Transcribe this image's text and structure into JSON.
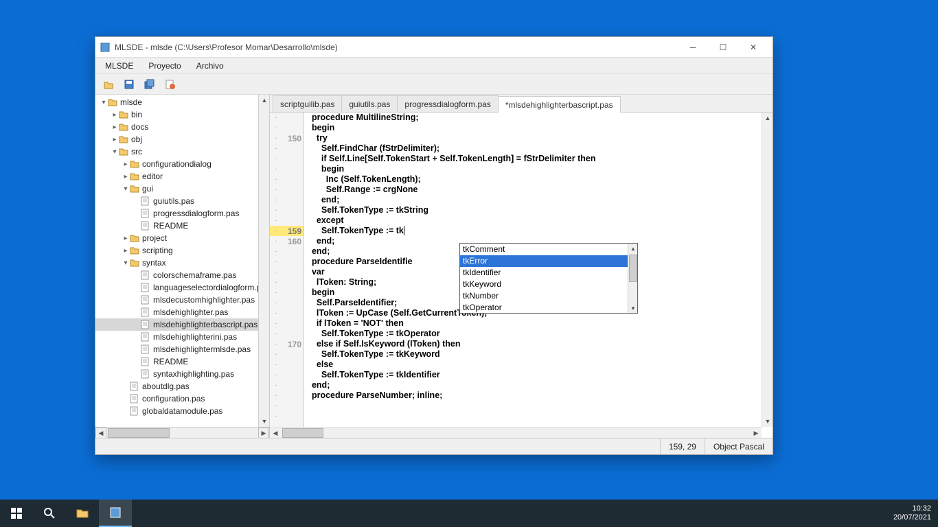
{
  "window": {
    "title": "MLSDE - mlsde (C:\\Users\\Profesor Momar\\Desarrollo\\mlsde)"
  },
  "menu": [
    "MLSDE",
    "Proyecto",
    "Archivo"
  ],
  "tree": [
    {
      "d": 0,
      "t": "mlsde",
      "k": "fo",
      "x": "▾"
    },
    {
      "d": 1,
      "t": "bin",
      "k": "fc",
      "x": "▸"
    },
    {
      "d": 1,
      "t": "docs",
      "k": "fc",
      "x": "▸"
    },
    {
      "d": 1,
      "t": "obj",
      "k": "fc",
      "x": "▸"
    },
    {
      "d": 1,
      "t": "src",
      "k": "fo",
      "x": "▾"
    },
    {
      "d": 2,
      "t": "configurationdialog",
      "k": "fc",
      "x": "▸"
    },
    {
      "d": 2,
      "t": "editor",
      "k": "fc",
      "x": "▸"
    },
    {
      "d": 2,
      "t": "gui",
      "k": "fo",
      "x": "▾"
    },
    {
      "d": 3,
      "t": "guiutils.pas",
      "k": "f"
    },
    {
      "d": 3,
      "t": "progressdialogform.pas",
      "k": "f"
    },
    {
      "d": 3,
      "t": "README",
      "k": "f"
    },
    {
      "d": 2,
      "t": "project",
      "k": "fc",
      "x": "▸"
    },
    {
      "d": 2,
      "t": "scripting",
      "k": "fc",
      "x": "▸"
    },
    {
      "d": 2,
      "t": "syntax",
      "k": "fo",
      "x": "▾"
    },
    {
      "d": 3,
      "t": "colorschemaframe.pas",
      "k": "f"
    },
    {
      "d": 3,
      "t": "languageselectordialogform.p",
      "k": "f"
    },
    {
      "d": 3,
      "t": "mlsdecustomhighlighter.pas",
      "k": "f"
    },
    {
      "d": 3,
      "t": "mlsdehighlighter.pas",
      "k": "f"
    },
    {
      "d": 3,
      "t": "mlsdehighlighterbascript.pas",
      "k": "f",
      "sel": true
    },
    {
      "d": 3,
      "t": "mlsdehighlighterini.pas",
      "k": "f"
    },
    {
      "d": 3,
      "t": "mlsdehighlightermlsde.pas",
      "k": "f"
    },
    {
      "d": 3,
      "t": "README",
      "k": "f"
    },
    {
      "d": 3,
      "t": "syntaxhighlighting.pas",
      "k": "f"
    },
    {
      "d": 2,
      "t": "aboutdlg.pas",
      "k": "f"
    },
    {
      "d": 2,
      "t": "configuration.pas",
      "k": "f"
    },
    {
      "d": 2,
      "t": "globaldatamodule.pas",
      "k": "f"
    }
  ],
  "tabs": [
    {
      "label": "scriptguilib.pas"
    },
    {
      "label": "guiutils.pas"
    },
    {
      "label": "progressdialogform.pas"
    },
    {
      "label": "*mlsdehighlighterbascript.pas",
      "active": true
    }
  ],
  "gutter_labels": {
    "150": "150",
    "159": "159",
    "160": "160",
    "170": "170"
  },
  "code_lines": [
    "  <kw>procedure</kw> MultilineString;",
    "  <kw>begin</kw>",
    "    <kw>try</kw>",
    "      Self.FindChar (fStrDelimiter);",
    "      <kw>if</kw> Self.Line[Self.TokenStart + Self.TokenLength] = fStrDelimiter <kw>then</kw>",
    "      <kw>begin</kw>",
    "        Inc (Self.TokenLength);",
    "        Self.Range := crgNone",
    "      <kw>end</kw>;",
    "      Self.TokenType := tkString",
    "    <kw>except</kw>",
    "      Self.TokenType := tk<span class='caret'></span>",
    "    <kw>end</kw>;",
    "  <kw>end</kw>;",
    "",
    "  <kw>procedure</kw> ParseIdentifie",
    "  <kw>var</kw>",
    "    lToken: <kw>String</kw>;",
    "  <kw>begin</kw>",
    "    Self.ParseIdentifier;",
    "    lToken := UpCase (Self.GetCurrentToken);",
    "    <kw>if</kw> lToken = <str>'NOT'</str> <kw>then</kw>",
    "      Self.TokenType := tkOperator",
    "    <kw>else if</kw> Self.IsKeyword (lToken) <kw>then</kw>",
    "      Self.TokenType := tkKeyword",
    "    <kw>else</kw>",
    "      Self.TokenType := tkIdentifier",
    "  <kw>end</kw>;",
    "",
    "  <kw>procedure</kw> ParseNumber; <kw>inline</kw>;"
  ],
  "autocomplete": {
    "items": [
      "tkComment",
      "tkError",
      "tkIdentifier",
      "tkKeyword",
      "tkNumber",
      "tkOperator"
    ],
    "selected": 1
  },
  "status": {
    "pos": "159, 29",
    "lang": "Object Pascal"
  },
  "taskbar": {
    "time": "10:32",
    "date": "20/07/2021"
  }
}
